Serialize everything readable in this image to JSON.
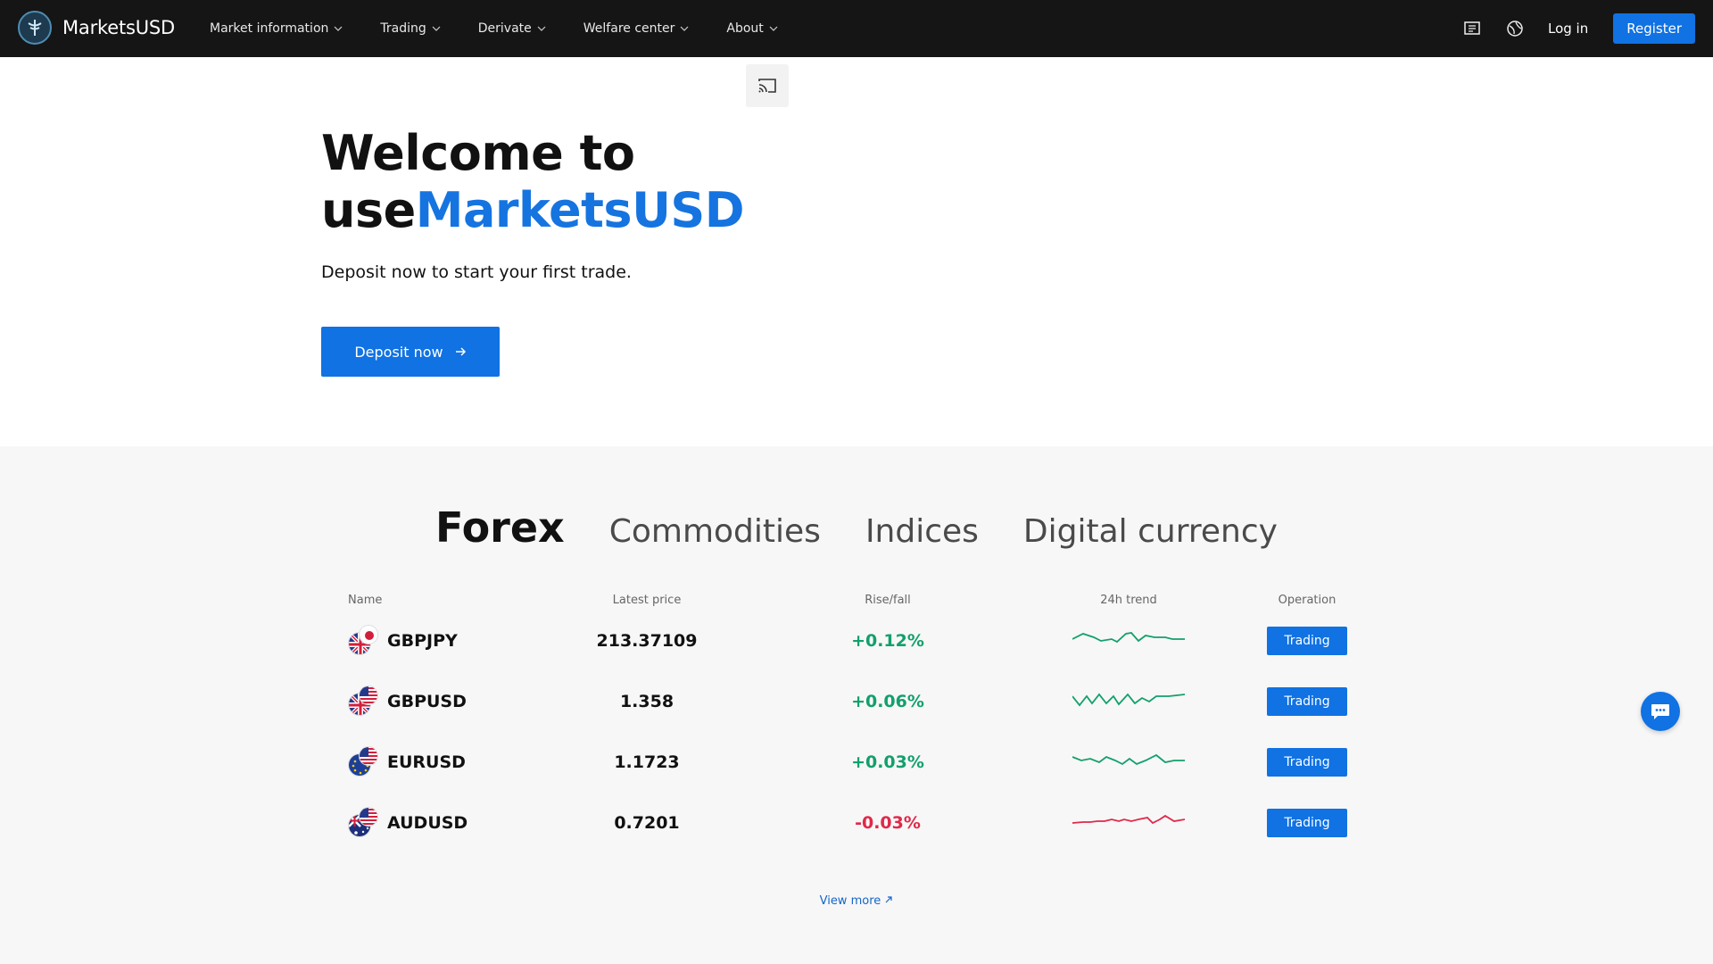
{
  "brand": {
    "name": "MarketsUSD"
  },
  "nav": {
    "items": [
      {
        "label": "Market information"
      },
      {
        "label": "Trading"
      },
      {
        "label": "Derivate"
      },
      {
        "label": "Welfare center"
      },
      {
        "label": "About"
      }
    ],
    "login": "Log in",
    "register": "Register"
  },
  "hero": {
    "title_line1": "Welcome to",
    "title_prefix": "use",
    "title_brand": "MarketsUSD",
    "subtitle": "Deposit now to start your first trade.",
    "cta": "Deposit now"
  },
  "market": {
    "tabs": [
      "Forex",
      "Commodities",
      "Indices",
      "Digital currency"
    ],
    "active_tab": "Forex",
    "columns": [
      "Name",
      "Latest price",
      "Rise/fall",
      "24h trend",
      "Operation"
    ],
    "rows": [
      {
        "name": "GBPJPY",
        "price": "213.37109",
        "change": "+0.12%",
        "direction": "up",
        "action": "Trading"
      },
      {
        "name": "GBPUSD",
        "price": "1.358",
        "change": "+0.06%",
        "direction": "up",
        "action": "Trading"
      },
      {
        "name": "EURUSD",
        "price": "1.1723",
        "change": "+0.03%",
        "direction": "up",
        "action": "Trading"
      },
      {
        "name": "AUDUSD",
        "price": "0.7201",
        "change": "-0.03%",
        "direction": "down",
        "action": "Trading"
      }
    ],
    "view_more": "View more"
  },
  "colors": {
    "accent": "#1072e3",
    "up": "#12a06c",
    "down": "#e0294a",
    "topbar": "#151515"
  },
  "icons": [
    "logo-icon",
    "chevron-down-icon",
    "news-icon",
    "language-icon",
    "cast-icon",
    "arrow-right-icon",
    "external-link-icon",
    "chat-icon"
  ]
}
